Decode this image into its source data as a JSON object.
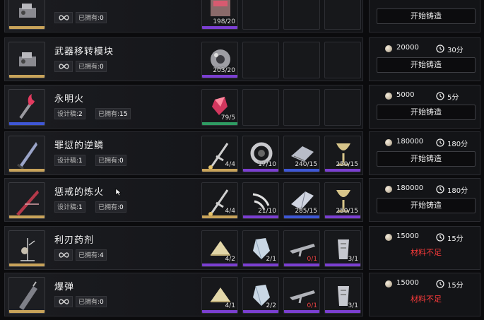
{
  "colors": {
    "tier_gold": "#c8a35a",
    "tier_blue": "#3f57d6",
    "tier_purple": "#7b3fd1",
    "tier_green": "#2f9b63",
    "warning_red": "#ff3b3b"
  },
  "ui": {
    "forge_label": "开始铸造",
    "insufficient_label": "材料不足",
    "owned_label": "已拥有:",
    "blueprint_label": "设计稿:"
  },
  "items": [
    {
      "name": "",
      "blueprint": "",
      "owned": "0",
      "icon": "module-icon",
      "tier": "gold",
      "materials": [
        {
          "icon": "crate-icon",
          "count": "198/20",
          "tier": "purple",
          "low": false
        }
      ],
      "cost": "",
      "time": "",
      "status": "forge"
    },
    {
      "name": "武器移转模块",
      "blueprint": "",
      "owned": "0",
      "icon": "module-icon",
      "tier": "gold",
      "materials": [
        {
          "icon": "sphere-core-icon",
          "count": "203/20",
          "tier": "purple",
          "low": false
        }
      ],
      "cost": "20000",
      "time": "30分",
      "status": "forge"
    },
    {
      "name": "永明火",
      "blueprint": "2",
      "owned": "15",
      "icon": "torch-icon",
      "tier": "blue",
      "materials": [
        {
          "icon": "red-crystal-icon",
          "count": "79/5",
          "tier": "green",
          "low": false
        }
      ],
      "cost": "5000",
      "time": "5分",
      "status": "forge"
    },
    {
      "name": "罪愆的逆鳞",
      "blueprint": "1",
      "owned": "0",
      "icon": "blade-icon",
      "tier": "gold",
      "materials": [
        {
          "icon": "hilt-icon",
          "count": "4/4",
          "tier": "gold",
          "low": false
        },
        {
          "icon": "ring-gear-icon",
          "count": "17/10",
          "tier": "purple",
          "low": false
        },
        {
          "icon": "plate-icon",
          "count": "240/15",
          "tier": "blue",
          "low": false
        },
        {
          "icon": "goblet-icon",
          "count": "250/15",
          "tier": "purple",
          "low": false
        }
      ],
      "cost": "180000",
      "time": "180分",
      "status": "forge"
    },
    {
      "name": "惩戒的炼火",
      "blueprint": "1",
      "owned": "0",
      "icon": "fire-blade-icon",
      "tier": "gold",
      "materials": [
        {
          "icon": "hilt-icon",
          "count": "4/4",
          "tier": "gold",
          "low": false
        },
        {
          "icon": "claw-icon",
          "count": "21/10",
          "tier": "purple",
          "low": false
        },
        {
          "icon": "shard-icon",
          "count": "285/15",
          "tier": "blue",
          "low": false
        },
        {
          "icon": "goblet-icon",
          "count": "250/15",
          "tier": "purple",
          "low": false
        }
      ],
      "cost": "180000",
      "time": "180分",
      "status": "forge"
    },
    {
      "name": "利刃药剂",
      "blueprint": "",
      "owned": "4",
      "icon": "potion-stand-icon",
      "tier": "gold",
      "materials": [
        {
          "icon": "tent-icon",
          "count": "4/2",
          "tier": "purple",
          "low": false
        },
        {
          "icon": "crystal-icon",
          "count": "2/1",
          "tier": "purple",
          "low": false
        },
        {
          "icon": "rifle-icon",
          "count": "0/1",
          "tier": "purple",
          "low": true
        },
        {
          "icon": "gauntlet-icon",
          "count": "3/1",
          "tier": "purple",
          "low": false
        }
      ],
      "cost": "15000",
      "time": "15分",
      "status": "insufficient"
    },
    {
      "name": "爆弹",
      "blueprint": "",
      "owned": "0",
      "icon": "bomb-icon",
      "tier": "gold",
      "materials": [
        {
          "icon": "tent-icon",
          "count": "4/1",
          "tier": "purple",
          "low": false
        },
        {
          "icon": "crystal-icon",
          "count": "2/2",
          "tier": "purple",
          "low": false
        },
        {
          "icon": "rifle-icon",
          "count": "0/1",
          "tier": "purple",
          "low": true
        },
        {
          "icon": "gauntlet-icon",
          "count": "3/1",
          "tier": "purple",
          "low": false
        }
      ],
      "cost": "15000",
      "time": "15分",
      "status": "insufficient"
    }
  ]
}
